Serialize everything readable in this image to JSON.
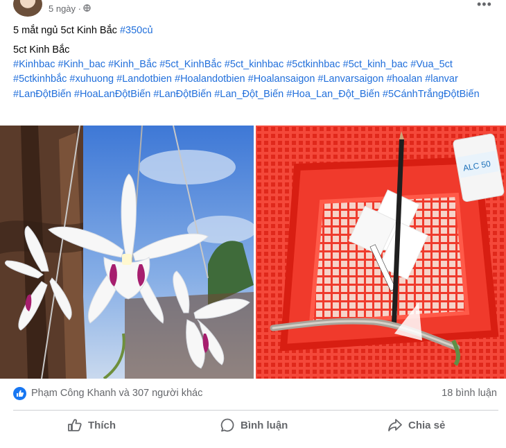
{
  "header": {
    "time": "5 ngày ·"
  },
  "post": {
    "line1_prefix": "5 mắt ngủ 5ct Kinh Bắc ",
    "line1_tag": "#350củ",
    "line2": "5ct Kinh Bắc",
    "tags": [
      "#Kinhbac",
      "#Kinh_bac",
      "#Kinh_Bắc",
      "#5ct_KinhBắc",
      "#5ct_kinhbac",
      "#5ctkinhbac",
      "#5ct_kinh_bac",
      "#Vua_5ct",
      "#5ctkinhbắc",
      "#xuhuong",
      "#Landotbien",
      "#Hoalandotbien",
      "#Hoalansaigon",
      "#Lanvarsaigon",
      "#hoalan",
      "#lanvar",
      "#LanĐộtBiến",
      "#HoaLanĐộtBiến",
      "#LanĐộtBiến",
      "#Lan_Đột_Biến",
      "#Hoa_Lan_Đột_Biến",
      "#5CánhTrắngĐộtBiến"
    ]
  },
  "photos": {
    "left": "white-orchid-flowers-photo",
    "right": "red-basket-cutting-photo",
    "bottle_label": "ALC 50"
  },
  "reactions": {
    "text": "Phạm Công Khanh và 307 người khác",
    "comments": "18 bình luận"
  },
  "actions": {
    "like": "Thích",
    "comment": "Bình luận",
    "share": "Chia sẻ"
  },
  "colors": {
    "link": "#216fdb",
    "like_blue": "#1877f2",
    "muted": "#65676b"
  }
}
